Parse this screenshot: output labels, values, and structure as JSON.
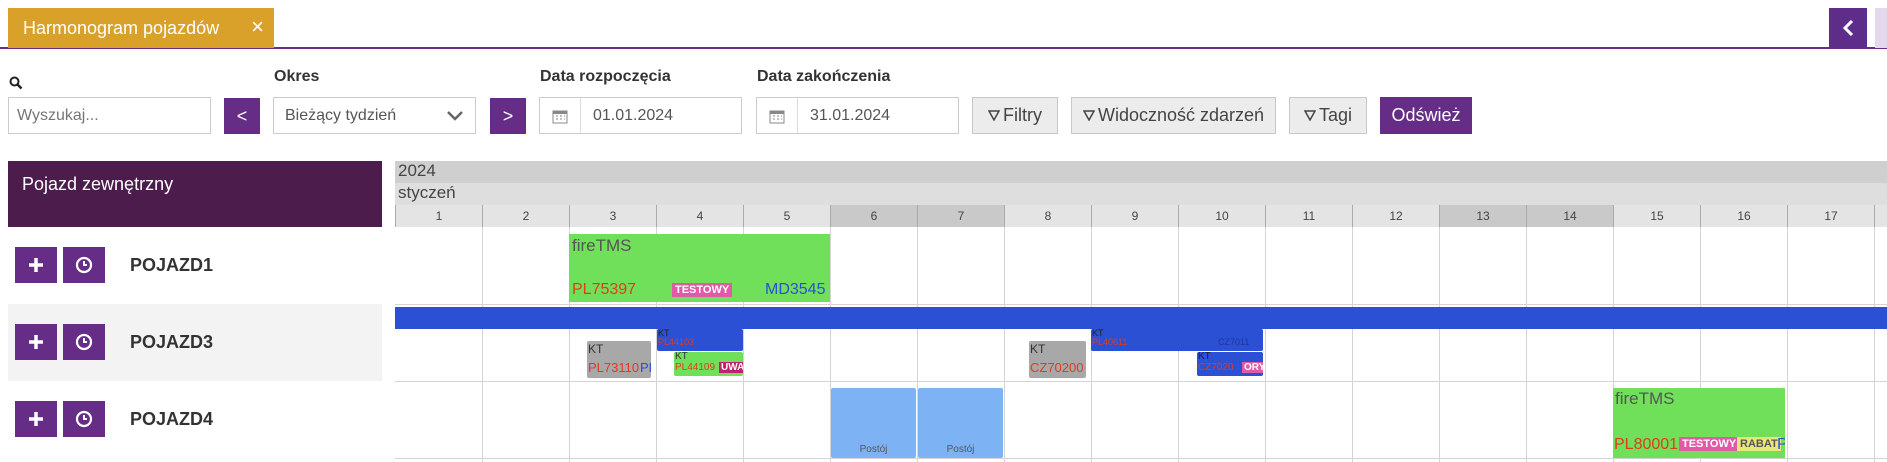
{
  "tab": {
    "title": "Harmonogram pojazdów",
    "close": "×"
  },
  "toolbar": {
    "search_label_icon": "search-icon",
    "search_placeholder": "Wyszukaj...",
    "prev_label": "<",
    "next_label": ">",
    "period_label": "Okres",
    "period_value": "Bieżący tydzień",
    "start_label": "Data rozpoczęcia",
    "start_value": "01.01.2024",
    "end_label": "Data zakończenia",
    "end_value": "31.01.2024",
    "filters_label": "Filtry",
    "visibility_label": "Widoczność zdarzeń",
    "tags_label": "Tagi",
    "refresh_label": "Odśwież"
  },
  "grid": {
    "left_header": "Pojazd zewnętrzny",
    "year": "2024",
    "month": "styczeń",
    "days": [
      "1",
      "2",
      "3",
      "4",
      "5",
      "6",
      "7",
      "8",
      "9",
      "10",
      "11",
      "12",
      "13",
      "14",
      "15",
      "16",
      "17"
    ],
    "weekend_days": [
      "6",
      "7",
      "13",
      "14"
    ]
  },
  "vehicles": [
    {
      "name": "POJAZD1"
    },
    {
      "name": "POJAZD3"
    },
    {
      "name": "POJAZD4"
    }
  ],
  "events": {
    "p1_firetms": {
      "title": "fireTMS",
      "left_code": "PL75397",
      "tag": "TESTOWY",
      "right_code": "MD3545"
    },
    "p3_kt1": {
      "title": "KT",
      "code": "PL73110",
      "code2": "PL"
    },
    "p3_kt2": {
      "title": "KT",
      "code": "PL44103",
      "code2": ""
    },
    "p3_kt3": {
      "title": "KT",
      "code": "PL44109",
      "tag": "UWA"
    },
    "p3_kt4": {
      "title": "KT",
      "code": "CZ70200"
    },
    "p3_kt5": {
      "title": "KT",
      "code": "PL40611",
      "code2": "CZ7011"
    },
    "p3_kt6": {
      "title": "KT",
      "code": "CZ7020",
      "tag": "ORY"
    },
    "p4_postoj1": {
      "label": "Postój"
    },
    "p4_postoj2": {
      "label": "Postój"
    },
    "p4_firetms": {
      "title": "fireTMS",
      "code": "PL80001",
      "tag1": "TESTOWY",
      "tag2": "RABAT",
      "code2": "P"
    }
  },
  "colors": {
    "accent": "#652d86",
    "tab": "#d9a12a",
    "green_event": "#70e05a",
    "blue_bar": "#2b50d4",
    "gray_event": "#a8a8a8",
    "light_blue_event": "#7db3f5",
    "tag_pink": "#e05aa8",
    "tag_yellow": "#e8e87a"
  }
}
